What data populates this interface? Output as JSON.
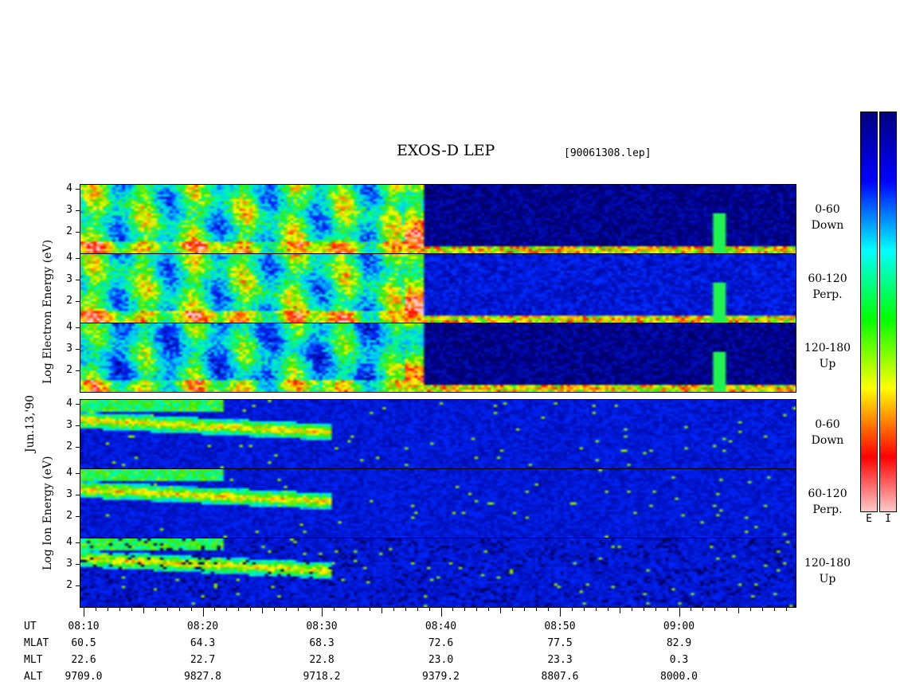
{
  "title": "EXOS-D LEP",
  "file_id": "[90061308.lep]",
  "date_label": "Jun.13,'90",
  "electron_ylabel": "Log  Electron  Energy  (eV)",
  "ion_ylabel": "Log   Ion   Energy  (eV)",
  "y_ticks": [
    "4",
    "3",
    "2"
  ],
  "panels": [
    {
      "species": "electron",
      "channel": "0-60",
      "direction": "Down"
    },
    {
      "species": "electron",
      "channel": "60-120",
      "direction": "Perp."
    },
    {
      "species": "electron",
      "channel": "120-180",
      "direction": "Up"
    },
    {
      "species": "ion",
      "channel": "0-60",
      "direction": "Down"
    },
    {
      "species": "ion",
      "channel": "60-120",
      "direction": "Perp."
    },
    {
      "species": "ion",
      "channel": "120-180",
      "direction": "Up"
    }
  ],
  "colorbar": {
    "labels": [
      "E",
      "I"
    ],
    "colors": [
      "#ffffff",
      "#ff0000",
      "#ffff00",
      "#00ff00",
      "#00ffff",
      "#0000ff",
      "#000080"
    ]
  },
  "x_axis": {
    "rows": [
      {
        "label": "UT",
        "values": [
          "08:10",
          "08:20",
          "08:30",
          "08:40",
          "08:50",
          "09:00"
        ]
      },
      {
        "label": "MLAT",
        "values": [
          "60.5",
          "64.3",
          "68.3",
          "72.6",
          "77.5",
          "82.9"
        ]
      },
      {
        "label": "MLT",
        "values": [
          "22.6",
          "22.7",
          "22.8",
          "23.0",
          "23.3",
          "0.3"
        ]
      },
      {
        "label": "ALT",
        "values": [
          "9709.0",
          "9827.8",
          "9718.2",
          "9379.2",
          "8807.6",
          "8000.0"
        ]
      }
    ]
  },
  "chart_data": {
    "type": "heatmap",
    "title": "EXOS-D LEP",
    "x": [
      "08:10",
      "08:20",
      "08:30",
      "08:40",
      "08:50",
      "09:00"
    ],
    "xlim": [
      "08:10",
      "09:10"
    ],
    "ylim": [
      1,
      4
    ],
    "yscale": "log energy (eV)",
    "series": [
      {
        "name": "0-60 Down",
        "species": "electron"
      },
      {
        "name": "60-120 Perp.",
        "species": "electron"
      },
      {
        "name": "120-180 Up",
        "species": "electron"
      },
      {
        "name": "0-60 Down",
        "species": "ion"
      },
      {
        "name": "60-120 Perp.",
        "species": "ion"
      },
      {
        "name": "120-180 Up",
        "species": "ion"
      }
    ]
  }
}
